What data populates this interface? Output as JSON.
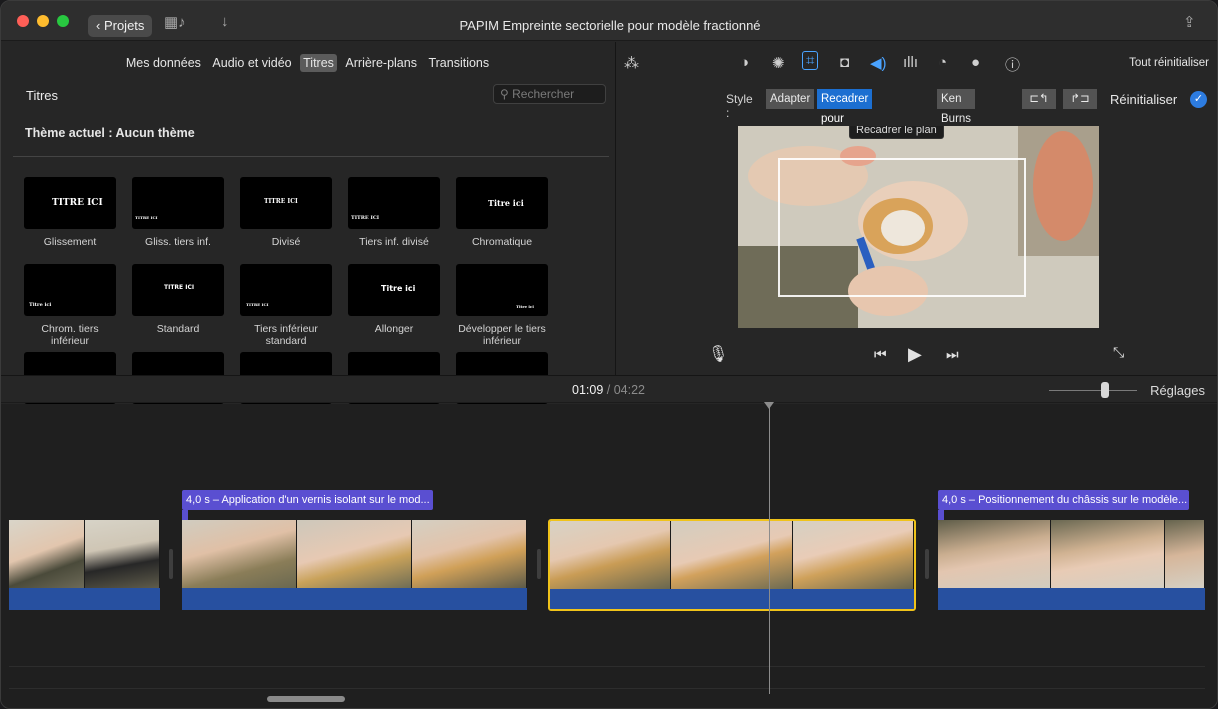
{
  "titlebar": {
    "projects_label": "Projets",
    "title": "PAPIM Empreinte sectorielle pour modèle fractionné",
    "icons": [
      "film-music-icon",
      "download-arrow-icon",
      "share-icon"
    ]
  },
  "browser": {
    "tabs": [
      {
        "label": "Mes données",
        "active": false
      },
      {
        "label": "Audio et vidéo",
        "active": false
      },
      {
        "label": "Titres",
        "active": true
      },
      {
        "label": "Arrière-plans",
        "active": false
      },
      {
        "label": "Transitions",
        "active": false
      }
    ],
    "section_title": "Titres",
    "search_placeholder": "Rechercher",
    "theme_label": "Thème actuel : Aucun thème",
    "tiles": [
      {
        "thumb": "TITRE ICI",
        "label": "Glissement"
      },
      {
        "thumb": "TITRE ICI",
        "label": "Gliss. tiers inf."
      },
      {
        "thumb": "TITRE ICI",
        "label": "Divisé"
      },
      {
        "thumb": "TITRE ICI",
        "label": "Tiers inf. divisé"
      },
      {
        "thumb": "Titre ici",
        "label": "Chromatique"
      },
      {
        "thumb": "Titre ici",
        "label": "Chrom. tiers inférieur"
      },
      {
        "thumb": "TITRE ICI",
        "label": "Standard"
      },
      {
        "thumb": "TITRE ICI",
        "label": "Tiers inférieur standard"
      },
      {
        "thumb": "Titre ici",
        "label": "Allonger"
      },
      {
        "thumb": "Titre ici",
        "label": "Développer le tiers inférieur"
      }
    ]
  },
  "viewer": {
    "reset_all": "Tout réinitialiser",
    "style_label": "Style :",
    "styles": [
      {
        "label": "Adapter",
        "selected": false
      },
      {
        "label": "Recadrer pour remplir",
        "selected": true
      },
      {
        "label": "Ken Burns",
        "selected": false
      }
    ],
    "reset": "Réinitialiser",
    "tooltip": "Recadrer le plan"
  },
  "timeline": {
    "current_time": "01:09",
    "separator": " / ",
    "total_time": "04:22",
    "settings_label": "Réglages",
    "title_clips": [
      {
        "text": "4,0 s – Application d'un vernis isolant sur le mod..."
      },
      {
        "text": "4,0 s – Positionnement du châssis sur le modèle..."
      }
    ]
  },
  "colors": {
    "accent": "#1c6fd1",
    "title_clip": "#5a4fd1",
    "audio_track": "#2750a0",
    "selection": "#f0c31a",
    "close": "#fe5f57",
    "minimize": "#febc2e",
    "zoom": "#28c840"
  }
}
